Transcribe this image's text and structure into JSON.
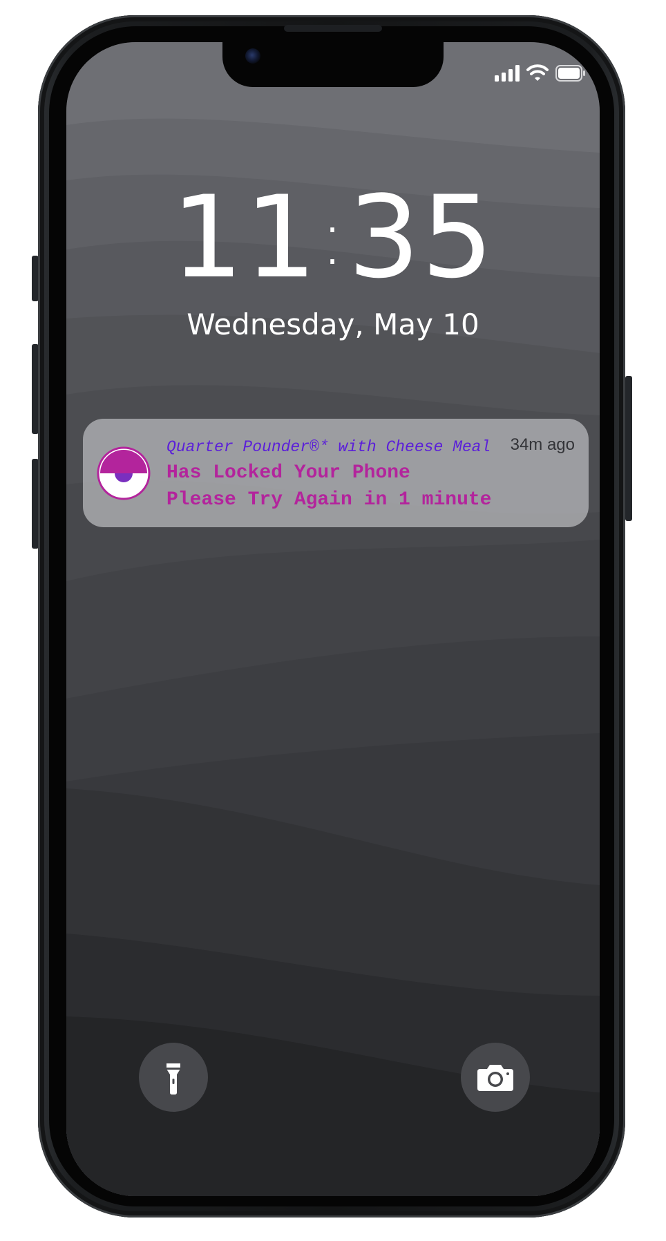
{
  "status_bar": {
    "signal_icon": "cellular-signal-icon",
    "wifi_icon": "wifi-icon",
    "battery_icon": "battery-icon"
  },
  "lock_screen": {
    "time_hours": "11",
    "time_separator": ":",
    "time_minutes": "35",
    "date": "Wednesday, May 10"
  },
  "notification": {
    "title": "Quarter Pounder®* with Cheese Meal",
    "time_ago": "34m ago",
    "line1": "Has Locked Your Phone",
    "line2": "Please Try Again in 1 minute",
    "app_icon": "app-icon",
    "colors": {
      "title": "#5b1fd9",
      "body": "#b3249c",
      "icon_accent": "#b3249c",
      "icon_pupil": "#7a2fbf"
    }
  },
  "quick_actions": {
    "left_icon": "flashlight-icon",
    "right_icon": "camera-icon"
  }
}
